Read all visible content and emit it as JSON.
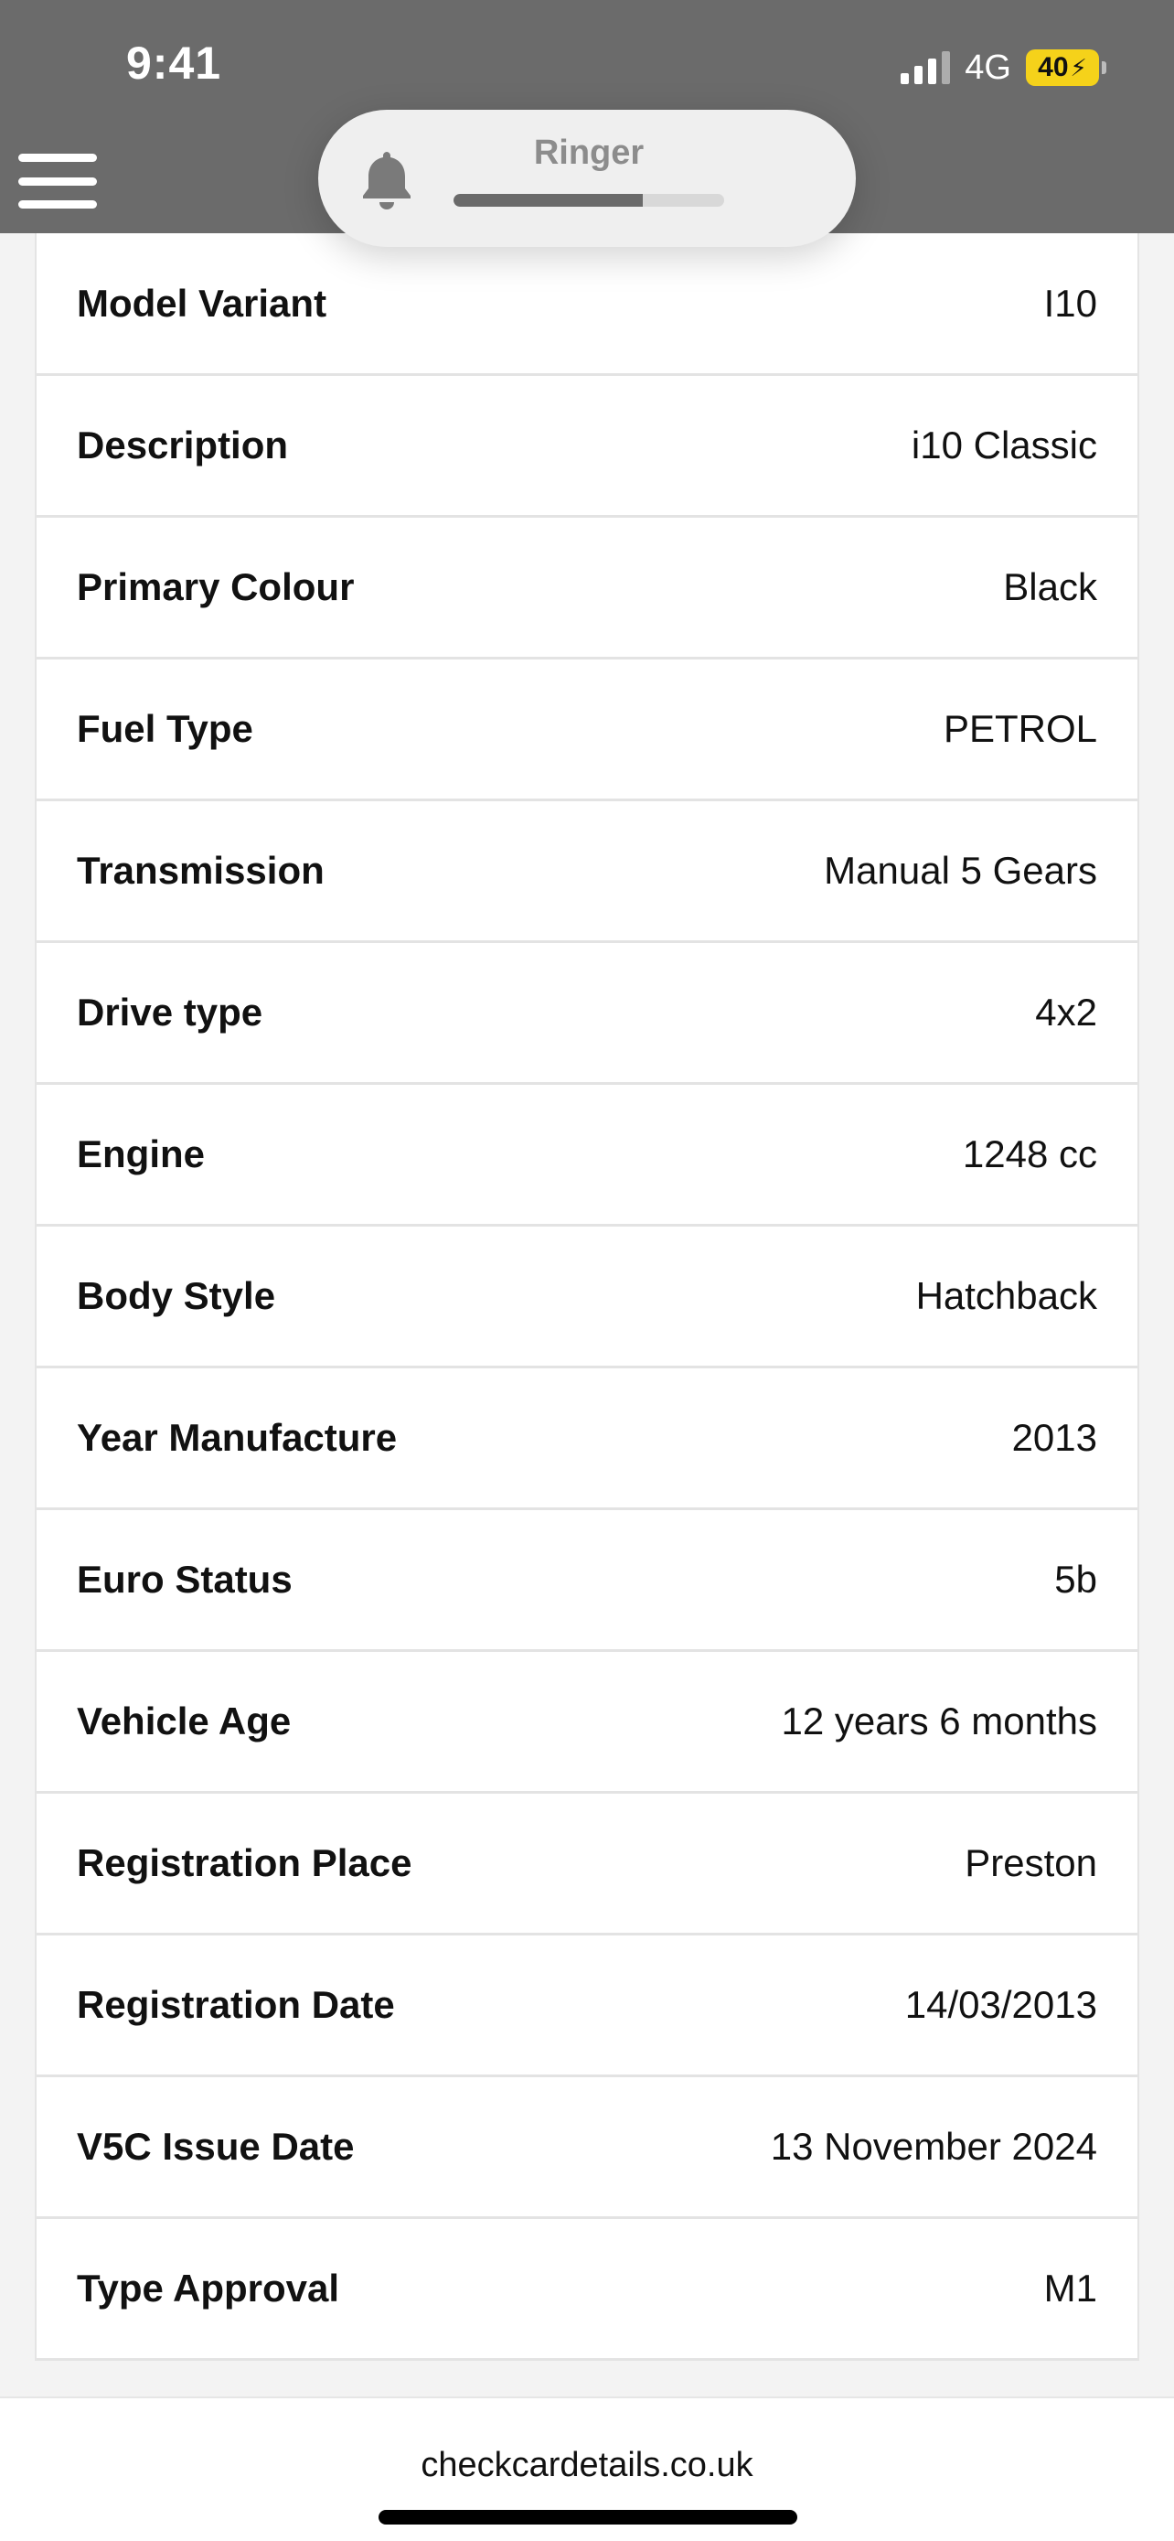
{
  "status_bar": {
    "time": "9:41",
    "network": "4G",
    "battery_level": "40",
    "battery_icon": "bolt-icon",
    "battery_color": "#f5d21a"
  },
  "ringer": {
    "label": "Ringer",
    "level": 0.7
  },
  "details": [
    {
      "label": "Model Variant",
      "value": "I10"
    },
    {
      "label": "Description",
      "value": "i10 Classic"
    },
    {
      "label": "Primary Colour",
      "value": "Black"
    },
    {
      "label": "Fuel Type",
      "value": "PETROL"
    },
    {
      "label": "Transmission",
      "value": "Manual 5 Gears"
    },
    {
      "label": "Drive type",
      "value": "4x2"
    },
    {
      "label": "Engine",
      "value": "1248 cc"
    },
    {
      "label": "Body Style",
      "value": "Hatchback"
    },
    {
      "label": "Year Manufacture",
      "value": "2013"
    },
    {
      "label": "Euro Status",
      "value": "5b"
    },
    {
      "label": "Vehicle Age",
      "value": "12 years 6 months"
    },
    {
      "label": "Registration Place",
      "value": "Preston"
    },
    {
      "label": "Registration Date",
      "value": "14/03/2013"
    },
    {
      "label": "V5C Issue Date",
      "value": "13 November 2024"
    },
    {
      "label": "Type Approval",
      "value": "M1"
    }
  ],
  "browser": {
    "url": "checkcardetails.co.uk"
  }
}
